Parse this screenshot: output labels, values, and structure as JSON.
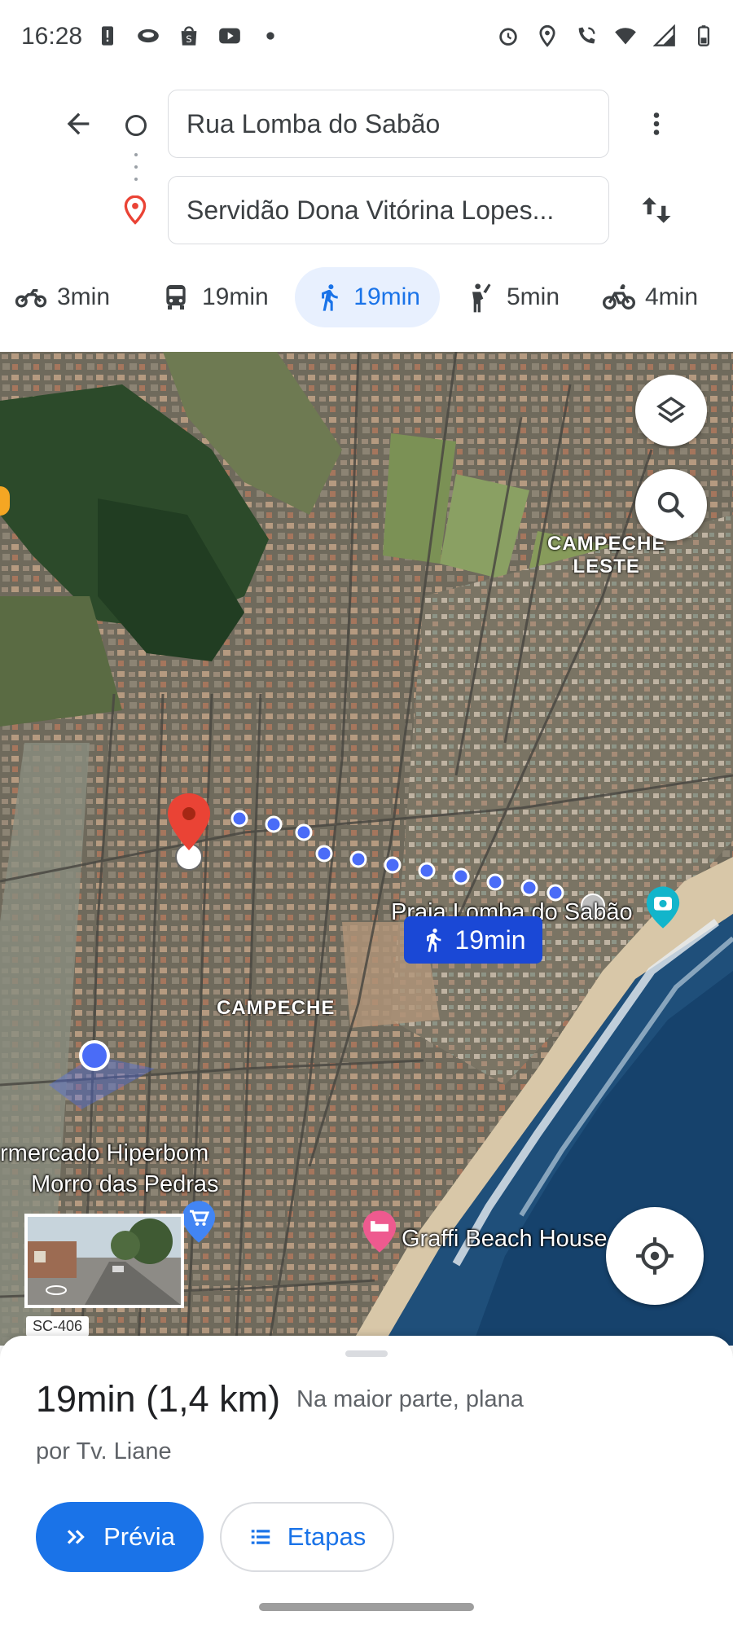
{
  "status_bar": {
    "time": "16:28",
    "left_icons": [
      "alert-icon",
      "eye-icon",
      "shopping-bag-icon",
      "youtube-icon",
      "dot-icon"
    ],
    "right_icons": [
      "alarm-icon",
      "location-icon",
      "wifi-call-icon",
      "wifi-icon",
      "signal-icon",
      "battery-icon"
    ]
  },
  "directions": {
    "origin": "Rua Lomba do Sabão",
    "destination": "Servidão Dona Vitórina Lopes..."
  },
  "modes": [
    {
      "name": "motorcycle",
      "icon": "motorcycle-icon",
      "label": "3min"
    },
    {
      "name": "transit",
      "icon": "bus-icon",
      "label": "19min"
    },
    {
      "name": "walking",
      "icon": "walk-icon",
      "label": "19min",
      "selected": true
    },
    {
      "name": "ride",
      "icon": "hail-icon",
      "label": "5min"
    },
    {
      "name": "bike",
      "icon": "bike-icon",
      "label": "4min"
    }
  ],
  "map": {
    "area_labels": [
      "CAMPECHE\nLESTE",
      "CAMPECHE"
    ],
    "area_label_1": "CAMPECHE",
    "area_label_1b": "LESTE",
    "area_label_2": "CAMPECHE",
    "place_praia": "Praia Lomba do Sabão",
    "place_market_1": "rmercado Hiperbom",
    "place_market_2": "Morro das Pedras",
    "place_graffi": "Graffi Beach House",
    "road_label": "SC-406",
    "walk_badge": "19min"
  },
  "route": {
    "time_distance": "19min (1,4 km)",
    "description": "Na maior parte, plana",
    "via": "por Tv. Liane"
  },
  "actions": {
    "preview": "Prévia",
    "steps": "Etapas"
  },
  "colors": {
    "accent": "#1a73e8",
    "route_dots": "#4a6cf7",
    "pin_red": "#ea4335",
    "badge_blue": "#1a48d6"
  }
}
